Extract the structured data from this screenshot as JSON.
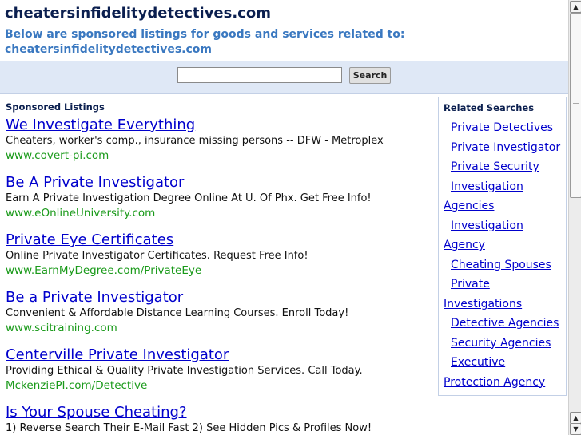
{
  "header": {
    "domain": "cheatersinfidelitydetectives.com",
    "intro_line1": "Below are sponsored listings for goods and services related to:",
    "intro_line2": "cheatersinfidelitydetectives.com"
  },
  "search": {
    "placeholder": "",
    "button_label": "Search"
  },
  "sponsored": {
    "heading": "Sponsored Listings",
    "listings": [
      {
        "title": "We Investigate Everything",
        "description": "Cheaters, worker's comp., insurance missing persons -- DFW - Metroplex",
        "url": "www.covert-pi.com"
      },
      {
        "title": "Be A Private Investigator",
        "description": "Earn A Private Investigation Degree Online At U. Of Phx. Get Free Info!",
        "url": "www.eOnlineUniversity.com"
      },
      {
        "title": "Private Eye Certificates",
        "description": "Online Private Investigator Certificates. Request Free Info!",
        "url": "www.EarnMyDegree.com/PrivateEye"
      },
      {
        "title": "Be a Private Investigator",
        "description": "Convenient & Affordable Distance Learning Courses. Enroll Today!",
        "url": "www.scitraining.com"
      },
      {
        "title": "Centerville Private Investigator",
        "description": "Providing Ethical & Quality Private Investigation Services. Call Today.",
        "url": "MckenziePI.com/Detective"
      },
      {
        "title": "Is Your Spouse Cheating?",
        "description": "1) Reverse Search Their E-Mail Fast 2) See Hidden Pics & Profiles Now!",
        "url": ""
      }
    ]
  },
  "related": {
    "heading": "Related Searches",
    "items": [
      {
        "line1": "Private Detectives",
        "line2": ""
      },
      {
        "line1": "Private Investigator",
        "line2": ""
      },
      {
        "line1": "Private Security",
        "line2": ""
      },
      {
        "line1": "Investigation",
        "line2": "Agencies"
      },
      {
        "line1": "Investigation",
        "line2": "Agency"
      },
      {
        "line1": "Cheating Spouses",
        "line2": ""
      },
      {
        "line1": "Private",
        "line2": "Investigations"
      },
      {
        "line1": "Detective Agencies",
        "line2": ""
      },
      {
        "line1": "Security Agencies",
        "line2": ""
      },
      {
        "line1": "Executive",
        "line2": "Protection Agency"
      }
    ]
  },
  "scrollbar": {
    "up_icon": "arrow-up-icon",
    "down_icon": "arrow-down-icon",
    "position_fraction": 0.0
  }
}
